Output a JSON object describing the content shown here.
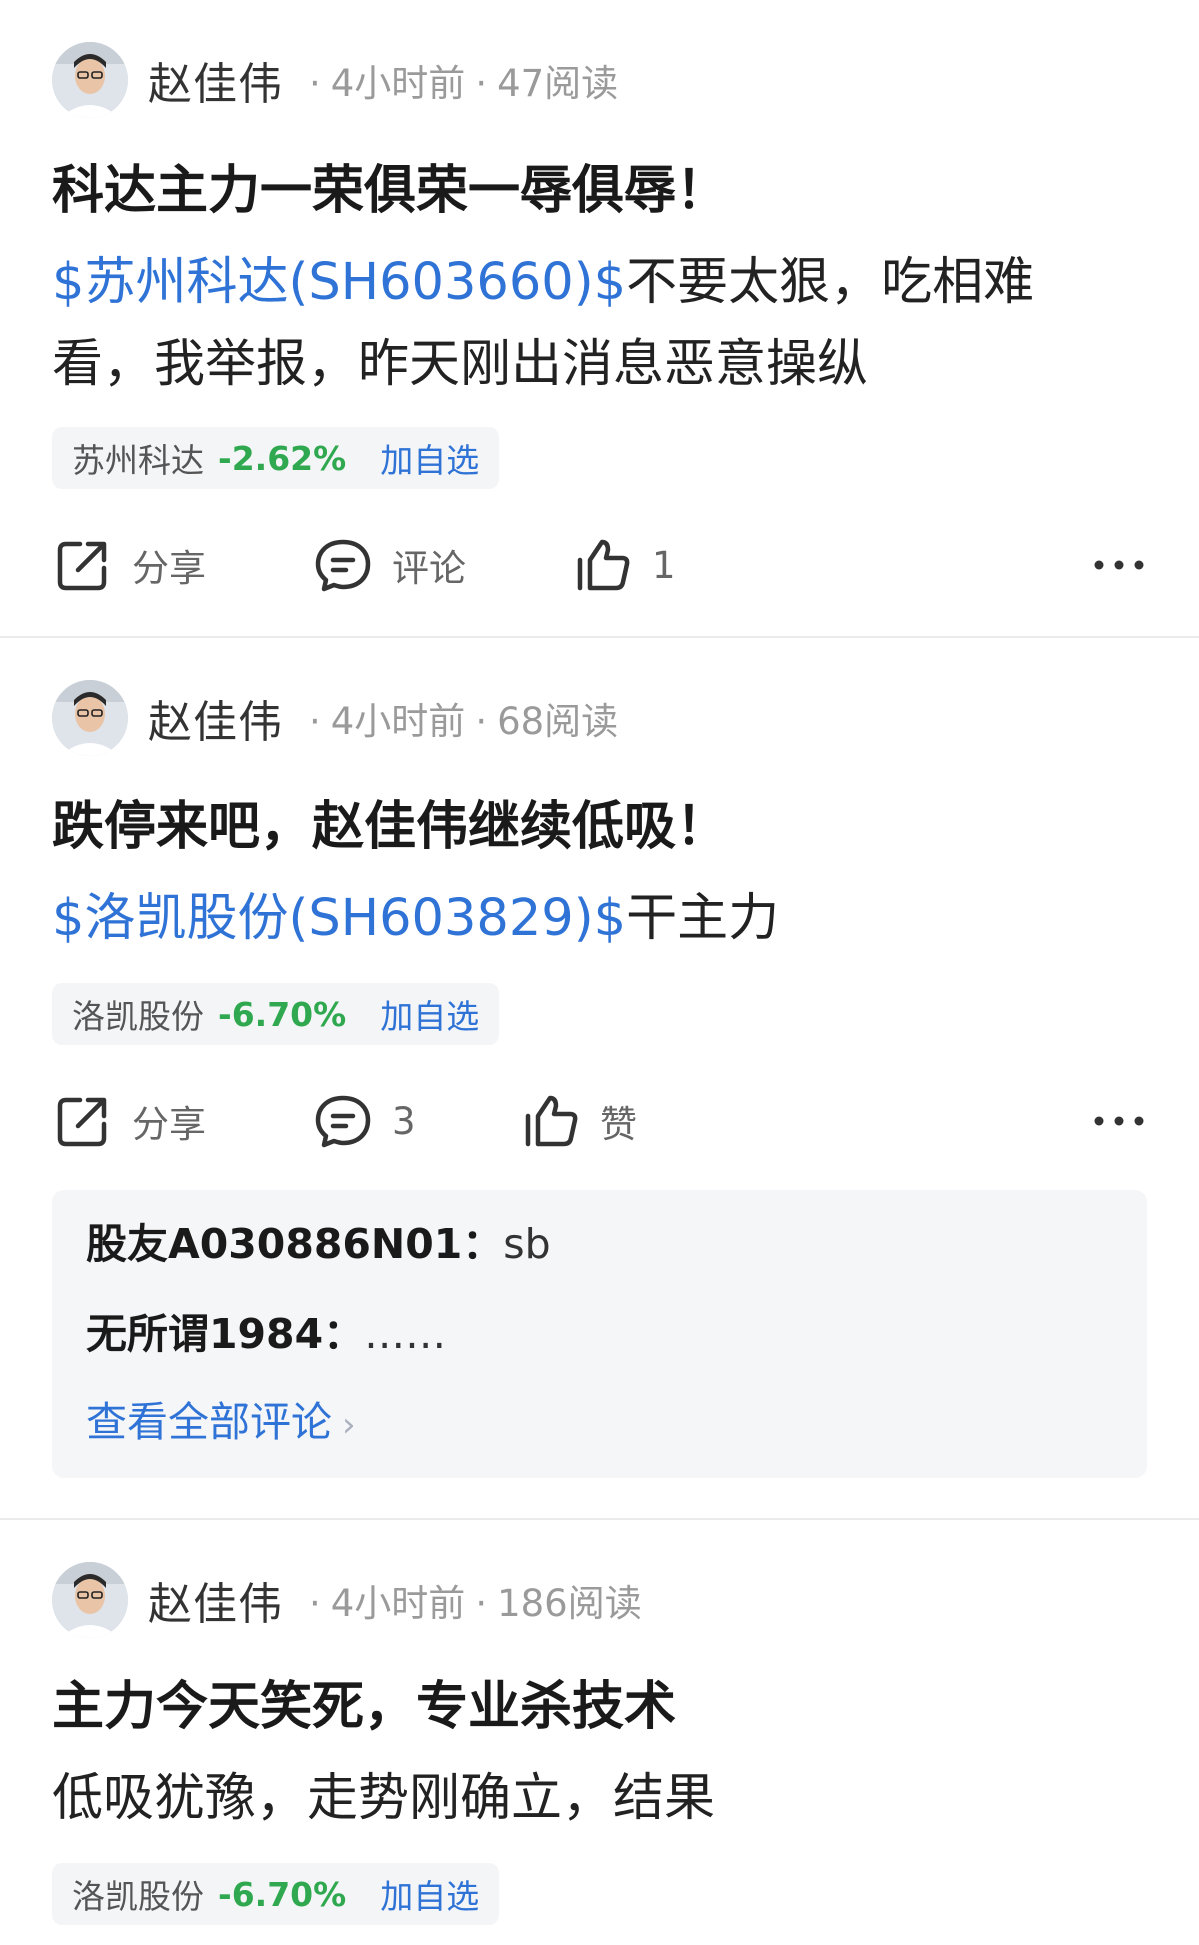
{
  "posts": [
    {
      "author": "赵佳伟",
      "time": "4小时前",
      "reads": "47阅读",
      "title": "科达主力一荣俱荣一辱俱辱！",
      "body_line1_link": "$苏州科达(SH603660)$",
      "body_line1_text": "不要太狠，吃相难",
      "body_line2_text": "看，我举报，昨天刚出消息恶意操纵",
      "stock": {
        "name": "苏州科达",
        "change": "-2.62%",
        "add_label": "加自选"
      },
      "actions": {
        "share": "分享",
        "comment": "评论",
        "like": "1"
      }
    },
    {
      "author": "赵佳伟",
      "time": "4小时前",
      "reads": "68阅读",
      "title": "跌停来吧，赵佳伟继续低吸！",
      "body_line1_link": "$洛凯股份(SH603829)$",
      "body_line1_text": "干主力",
      "stock": {
        "name": "洛凯股份",
        "change": "-6.70%",
        "add_label": "加自选"
      },
      "actions": {
        "share": "分享",
        "comment": "3",
        "like": "赞"
      },
      "comments": [
        {
          "user": "股友A030886N01：",
          "text": "sb"
        },
        {
          "user": "无所谓1984：",
          "text": "……"
        }
      ],
      "view_all": "查看全部评论"
    },
    {
      "author": "赵佳伟",
      "time": "4小时前",
      "reads": "186阅读",
      "title": "主力今天笑死，专业杀技术",
      "body_line1_text": "低吸犹豫，走势刚确立，结果",
      "stock": {
        "name": "洛凯股份",
        "change": "-6.70%",
        "add_label": "加自选"
      }
    }
  ],
  "colors": {
    "link": "#2f73d6",
    "negative_change": "#2fa84f",
    "tag_bg": "#f4f5f7"
  },
  "icons": [
    "share-icon",
    "comment-icon",
    "like-icon",
    "more-icon",
    "chevron-right-icon",
    "avatar"
  ]
}
